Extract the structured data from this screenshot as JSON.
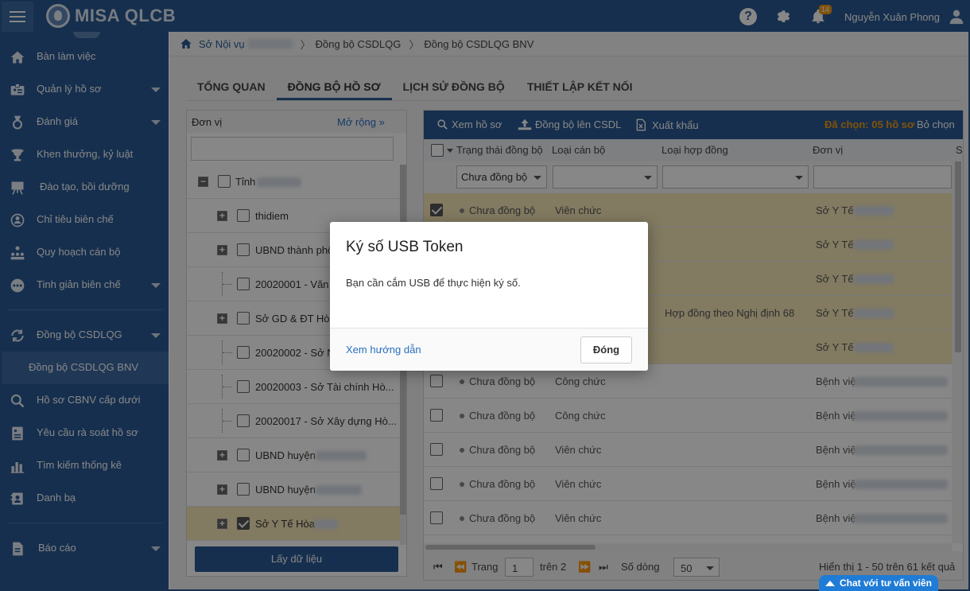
{
  "app": {
    "logo_text": "MISA QLCB",
    "user_name": "Nguyễn Xuân Phong",
    "notification_count": "14",
    "brand_color": "#2a5a94"
  },
  "sidebar": {
    "items": [
      {
        "label": "Bàn làm việc",
        "icon": "home-icon"
      },
      {
        "label": "Quản lý hồ sơ",
        "icon": "id-card-icon"
      },
      {
        "label": "Đánh giá",
        "icon": "medal-icon"
      },
      {
        "label": "Khen thưởng, kỷ luật",
        "icon": "trophy-icon"
      },
      {
        "label": "Đào tạo, bồi dưỡng",
        "icon": "presentation-icon"
      },
      {
        "label": "Chỉ tiêu biên chế",
        "icon": "target-user-icon"
      },
      {
        "label": "Quy hoạch cán bộ",
        "icon": "org-chart-icon"
      },
      {
        "label": "Tinh giản biên chế",
        "icon": "more-dots-icon"
      },
      {
        "label": "Đồng bộ CSDLQG",
        "icon": "sync-icon"
      },
      {
        "label": "Đồng bộ CSDLQG BNV",
        "icon": ""
      },
      {
        "label": "Hồ sơ CBNV cấp dưới",
        "icon": "search-icon"
      },
      {
        "label": "Yêu cầu rà soát hồ sơ",
        "icon": "document-list-icon"
      },
      {
        "label": "Tìm kiếm thống kê",
        "icon": "bar-chart-icon"
      },
      {
        "label": "Danh bạ",
        "icon": "contacts-icon"
      },
      {
        "label": "Báo cáo",
        "icon": "report-icon"
      }
    ]
  },
  "breadcrumb": {
    "items": [
      "Sở Nội vụ",
      "Đồng bộ CSDLQG",
      "Đồng bộ CSDLQG BNV"
    ]
  },
  "tabs": [
    "TỔNG QUAN",
    "ĐỒNG BỘ HỒ SƠ",
    "LỊCH SỬ ĐỒNG BỘ",
    "THIẾT LẬP KẾT NỐI"
  ],
  "left_panel": {
    "header": "Đơn vị",
    "expand": "Mở rộng",
    "search_value": "",
    "tree": [
      {
        "label": "Tỉnh",
        "checked": false
      },
      {
        "label": "thidiem",
        "checked": false
      },
      {
        "label": "UBND thành phố",
        "checked": false
      },
      {
        "label": "20020001 - Văn p",
        "checked": false
      },
      {
        "label": "Sở GD & ĐT Hòa",
        "checked": false
      },
      {
        "label": "20020002 - Sở N",
        "checked": false
      },
      {
        "label": "20020003 - Sở Tài chính Hò...",
        "checked": false
      },
      {
        "label": "20020017 - Sở Xây dựng Hò...",
        "checked": false
      },
      {
        "label": "UBND huyện",
        "checked": false
      },
      {
        "label": "UBND huyện",
        "checked": false
      },
      {
        "label": "Sở Y Tế Hòa",
        "checked": true
      }
    ],
    "button": "Lấy dữ liệu"
  },
  "toolbar": {
    "view": "Xem hồ sơ",
    "sync": "Đồng bộ lên CSDL",
    "export": "Xuất khẩu",
    "selected": "Đã chọn: 05 hồ sơ",
    "deselect": "Bỏ chọn"
  },
  "grid": {
    "columns": [
      "Trạng thái đồng bộ",
      "Loại cán bộ",
      "Loại hợp đồng",
      "Đơn vị",
      "S"
    ],
    "filters": [
      "Chưa đồng bộ",
      "",
      "",
      ""
    ],
    "rows": [
      {
        "status": "Chưa đồng bộ",
        "type": "Viên chức",
        "contract": "",
        "unit": "Sở Y Tế",
        "selected": true
      },
      {
        "status": "",
        "type": "",
        "contract": "",
        "unit": "Sở Y Tế",
        "selected": true
      },
      {
        "status": "",
        "type": "",
        "contract": "",
        "unit": "Sở Y Tế",
        "selected": true
      },
      {
        "status": "",
        "type": "",
        "contract": "Hợp đồng theo Nghị định 68",
        "unit": "Sở Y Tế",
        "selected": true
      },
      {
        "status": "",
        "type": "",
        "contract": "",
        "unit": "Sở Y Tế",
        "selected": true
      },
      {
        "status": "Chưa đồng bộ",
        "type": "Công chức",
        "contract": "",
        "unit": "Bệnh việ",
        "selected": false
      },
      {
        "status": "Chưa đồng bộ",
        "type": "Công chức",
        "contract": "",
        "unit": "Bệnh việ",
        "selected": false
      },
      {
        "status": "Chưa đồng bộ",
        "type": "Viên chức",
        "contract": "",
        "unit": "Bệnh việ",
        "selected": false
      },
      {
        "status": "Chưa đồng bộ",
        "type": "Viên chức",
        "contract": "",
        "unit": "Bệnh việ",
        "selected": false
      },
      {
        "status": "Chưa đồng bộ",
        "type": "Viên chức",
        "contract": "",
        "unit": "Bệnh việ",
        "selected": false
      }
    ]
  },
  "pager": {
    "page_label": "Trang",
    "page": "1",
    "of": "trên 2",
    "rows_label": "Số dòng",
    "rows": "50",
    "summary": "Hiển thị 1 - 50 trên 61 kết quả"
  },
  "modal": {
    "title": "Ký số USB Token",
    "body": "Bạn cần cắm USB để thực hiện ký số.",
    "link": "Xem hướng dẫn",
    "close": "Đóng"
  },
  "chat": {
    "label": "Chat với tư vấn viên"
  }
}
